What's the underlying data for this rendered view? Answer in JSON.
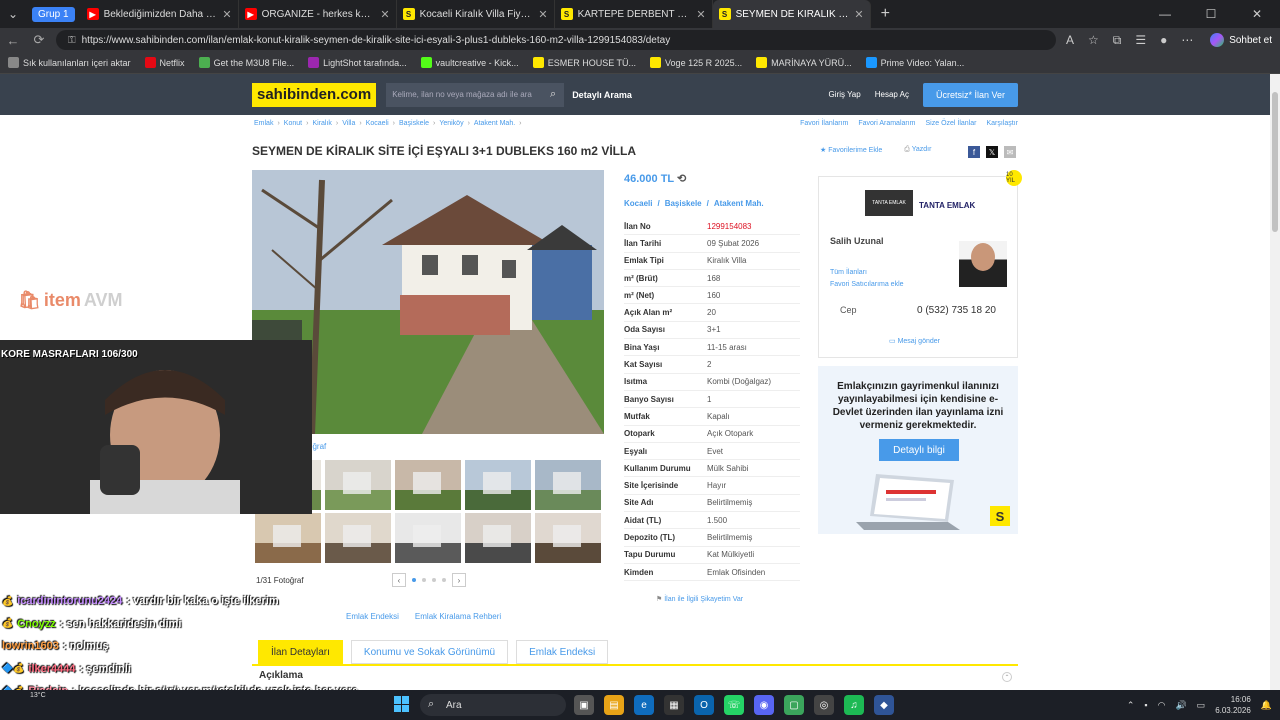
{
  "browser": {
    "group_label": "Grup 1",
    "tabs": [
      {
        "title": "Beklediğimizden Daha Samimi Bir",
        "fav_color": "#ff0000",
        "fav_text": "▶"
      },
      {
        "title": "ORGANIZE - herkes kendine yakışı",
        "fav_color": "#ff0000",
        "fav_text": "▶"
      },
      {
        "title": "Kocaeli Kiralık Villa Fiyatları sahibin",
        "fav_color": "#ffe800",
        "fav_text": "S"
      },
      {
        "title": "KARTEPE DERBENT DAĞ EVLERİ SA",
        "fav_color": "#ffe800",
        "fav_text": "S"
      },
      {
        "title": "SEYMEN DE KİRALIK SİTE İÇİ EŞYAL",
        "fav_color": "#ffe800",
        "fav_text": "S",
        "active": true
      }
    ],
    "url": "https://www.sahibinden.com/ilan/emlak-konut-kiralik-seymen-de-kiralik-site-ici-esyali-3-plus1-dubleks-160-m2-villa-1299154083/detay",
    "sohbet_label": "Sohbet et",
    "bookmarks": [
      {
        "label": "Sık kullanılanları içeri aktar",
        "color": "#888",
        "icon": "folder-icon"
      },
      {
        "label": "Netflix",
        "color": "#e50914",
        "icon": "netflix-icon"
      },
      {
        "label": "Get the M3U8 File...",
        "color": "#4caf50",
        "icon": "extension-icon"
      },
      {
        "label": "LightShot tarafında...",
        "color": "#9c27b0",
        "icon": "lightshot-icon"
      },
      {
        "label": "vaultcreative - Kick...",
        "color": "#53fc18",
        "icon": "kick-icon"
      },
      {
        "label": "ESMER HOUSE TÜ...",
        "color": "#ffe800",
        "icon": "sahibinden-icon"
      },
      {
        "label": "Voge 125 R 2025...",
        "color": "#ffe800",
        "icon": "sahibinden-icon"
      },
      {
        "label": "MARİNAYA YÜRÜ...",
        "color": "#ffe800",
        "icon": "sahibinden-icon"
      },
      {
        "label": "Prime Video: Yalan...",
        "color": "#1a98ff",
        "icon": "prime-icon"
      }
    ]
  },
  "site": {
    "logo": "sahibinden.com",
    "search_placeholder": "Kelime, ilan no veya mağaza adı ile ara",
    "detayli_arama": "Detaylı Arama",
    "giris": "Giriş Yap",
    "hesap_ac": "Hesap Aç",
    "ucretsiz": "Ücretsiz* İlan Ver",
    "breadcrumbs": [
      "Emlak",
      "Konut",
      "Kiralık",
      "Villa",
      "Kocaeli",
      "Başiskele",
      "Yeniköy",
      "Atakent Mah."
    ],
    "right_links": [
      "Favori İlanlarım",
      "Favori Aramalarım",
      "Size Özel İlanlar",
      "Karşılaştır"
    ],
    "title": "SEYMEN DE KİRALIK SİTE İÇİ EŞYALI 3+1 DUBLEKS 160 m2 VİLLA",
    "favorite": "★ Favorilerime Ekle",
    "print": "Yazdır",
    "photo_toolbar_label": "oğraf",
    "photo_count": "1/31 Fotoğraf",
    "photo_links": [
      "Emlak Endeksi",
      "Emlak Kiralama Rehberi"
    ],
    "price": "46.000 TL",
    "location": [
      "Kocaeli",
      "/",
      "Başiskele",
      "/",
      "Atakent Mah."
    ],
    "details": [
      {
        "k": "İlan No",
        "v": "1299154083",
        "red": true
      },
      {
        "k": "İlan Tarihi",
        "v": "09 Şubat 2026"
      },
      {
        "k": "Emlak Tipi",
        "v": "Kiralık Villa"
      },
      {
        "k": "m² (Brüt)",
        "v": "168"
      },
      {
        "k": "m² (Net)",
        "v": "160"
      },
      {
        "k": "Açık Alan m²",
        "v": "20"
      },
      {
        "k": "Oda Sayısı",
        "v": "3+1"
      },
      {
        "k": "Bina Yaşı",
        "v": "11-15 arası"
      },
      {
        "k": "Kat Sayısı",
        "v": "2"
      },
      {
        "k": "Isıtma",
        "v": "Kombi (Doğalgaz)"
      },
      {
        "k": "Banyo Sayısı",
        "v": "1"
      },
      {
        "k": "Mutfak",
        "v": "Kapalı"
      },
      {
        "k": "Otopark",
        "v": "Açık Otopark"
      },
      {
        "k": "Eşyalı",
        "v": "Evet"
      },
      {
        "k": "Kullanım Durumu",
        "v": "Mülk Sahibi"
      },
      {
        "k": "Site İçerisinde",
        "v": "Hayır"
      },
      {
        "k": "Site Adı",
        "v": "Belirtilmemiş"
      },
      {
        "k": "Aidat (TL)",
        "v": "1.500"
      },
      {
        "k": "Depozito (TL)",
        "v": "Belirtilmemiş"
      },
      {
        "k": "Tapu Durumu",
        "v": "Kat Mülkiyetli"
      },
      {
        "k": "Kimden",
        "v": "Emlak Ofisinden"
      }
    ],
    "complain": "İlan ile İlgili Şikayetim Var",
    "agency_logo_text": "TANTA EMLAK",
    "agency_name": "TANTA EMLAK",
    "agency_badge": "10 YIL",
    "seller_name": "Salih Uzunal",
    "seller_links": [
      "Tüm İlanları",
      "Favori Satıcılarıma ekle"
    ],
    "cep_label": "Cep",
    "cep_value": "0 (532) 735 18 20",
    "mesaj": "Mesaj gönder",
    "ad_text": "Emlakçınızın gayrimenkul ilanınızı yayınlayabilmesi için kendisine e-Devlet üzerinden ilan yayınlama izni vermeniz gerekmektedir.",
    "ad_button": "Detaylı bilgi",
    "ad_logo": "S",
    "detail_tabs": [
      "İlan Detayları",
      "Konumu ve Sokak Görünümü",
      "Emlak Endeksi"
    ],
    "aciklama": "Açıklama"
  },
  "overlay": {
    "itemavm_a": "item",
    "itemavm_b": "AVM",
    "webcam_label": "KORE MASRAFLARI 106/300",
    "chat": [
      {
        "badge": "💰",
        "user": "icardinintorunu2424",
        "color": "#c58cff",
        "msg": ": vardır bir kaka o işte ilkerim"
      },
      {
        "badge": "💰",
        "user": "Cnoyzz",
        "color": "#7cfc00",
        "msg": ": sen hakkaridesin dimi"
      },
      {
        "badge": "",
        "user": "lowrin1603",
        "color": "#ff9f43",
        "msg": ": nolmuş"
      },
      {
        "badge": "🔷💰",
        "user": "ilker4444",
        "color": "#ff6b81",
        "msg": ": şemdinli"
      },
      {
        "badge": "🔷💰",
        "user": "Riadein",
        "color": "#ff8fa3",
        "msg": ": kocaelinde bir sürü var müstakil de uzak işte her yere"
      }
    ]
  },
  "taskbar": {
    "temp": "13°C",
    "search": "Ara",
    "time": "16:06",
    "date": "6.03.2026"
  }
}
